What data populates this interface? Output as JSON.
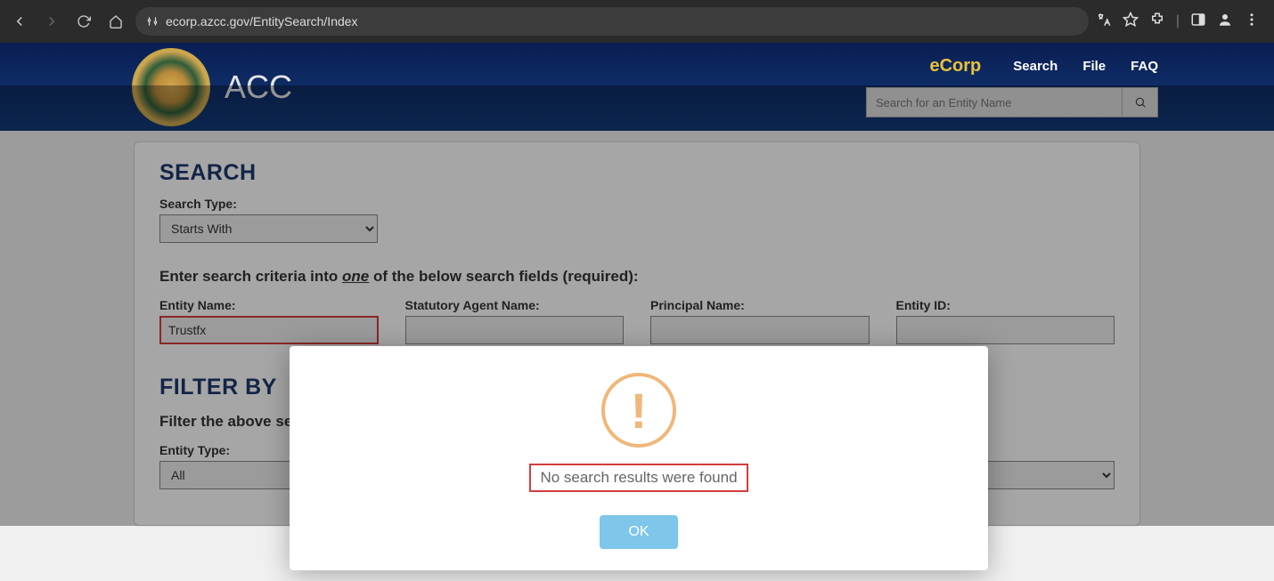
{
  "browser": {
    "url": "ecorp.azcc.gov/EntitySearch/Index"
  },
  "header": {
    "site_title": "ACC",
    "ecorp": "eCorp",
    "nav": {
      "search": "Search",
      "file": "File",
      "faq": "FAQ"
    },
    "search_placeholder": "Search for an Entity Name"
  },
  "search": {
    "section_title": "SEARCH",
    "search_type_label": "Search Type:",
    "search_type_value": "Starts With",
    "instruction_pre": "Enter search criteria into ",
    "instruction_u": "one",
    "instruction_post": " of the below search fields (required):",
    "fields": {
      "entity_name": {
        "label": "Entity Name:",
        "value": "Trustfx"
      },
      "agent_name": {
        "label": "Statutory Agent Name:",
        "value": ""
      },
      "principal_name": {
        "label": "Principal Name:",
        "value": ""
      },
      "entity_id": {
        "label": "Entity ID:",
        "value": ""
      }
    }
  },
  "filter": {
    "section_title": "FILTER BY",
    "instruction": "Filter the above se",
    "entity_type_label": "Entity Type:",
    "entity_type_value": "All"
  },
  "modal": {
    "message": "No search results were found",
    "ok": "OK"
  }
}
